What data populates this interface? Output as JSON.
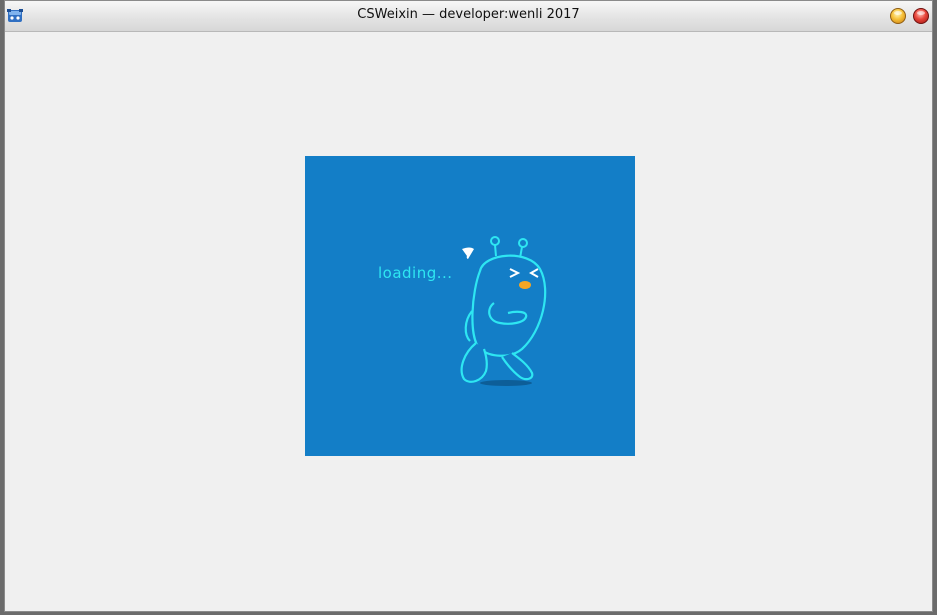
{
  "window": {
    "title": "CSWeixin — developer:wenli 2017",
    "app_icon": "app-icon",
    "buttons": {
      "minimize": "minimize-icon",
      "close": "close-icon"
    }
  },
  "splash": {
    "loading_text": "loading...",
    "background_color": "#137ec7",
    "accent_color": "#2ee6f2",
    "mascot": "mascot-illustration"
  }
}
